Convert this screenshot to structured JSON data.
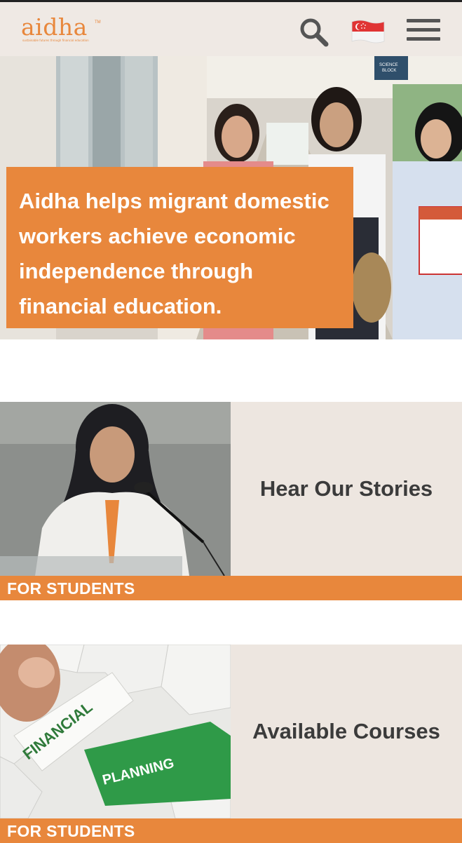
{
  "header": {
    "logo_text": "aidha",
    "logo_tagline": "sustainable futures through financial education",
    "logo_tm": "TM",
    "icons": {
      "search": "search-icon",
      "flag": "singapore-flag-icon",
      "menu": "hamburger-menu-icon"
    }
  },
  "hero": {
    "headline": "Aidha helps migrant domestic workers achieve economic independence through financial education.",
    "sign_text_1": "SCIENCE",
    "sign_text_2": "BLOCK"
  },
  "cards": [
    {
      "title": "Hear Our Stories",
      "category": "FOR STUDENTS"
    },
    {
      "title": "Available Courses",
      "category": "FOR STUDENTS",
      "puzzle_text_1": "FINANCIAL",
      "puzzle_text_2": "PLANNING"
    }
  ],
  "colors": {
    "accent": "#e8873c",
    "header_bg": "#efe9e4",
    "card_bg": "#ede6e0",
    "title": "#3b3b3b"
  }
}
